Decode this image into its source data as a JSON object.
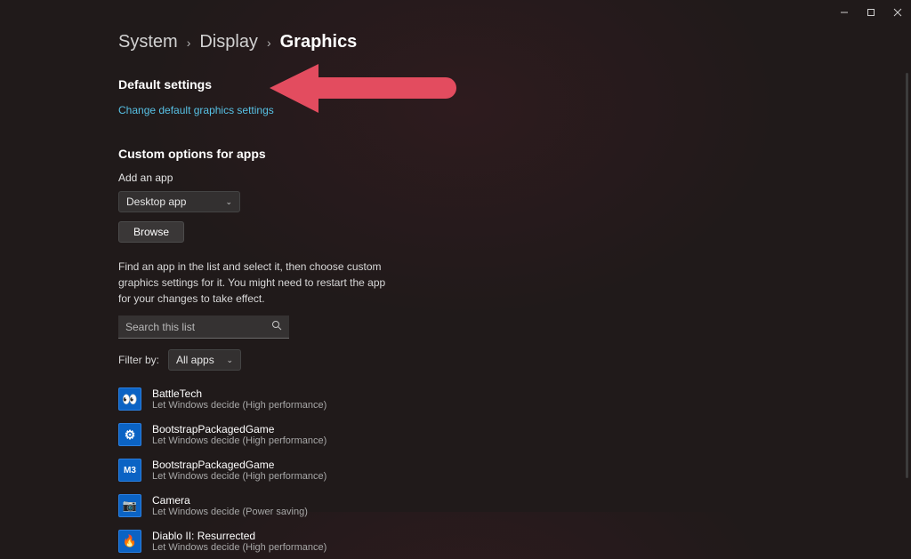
{
  "breadcrumb": {
    "c1": "System",
    "c2": "Display",
    "c3": "Graphics"
  },
  "default": {
    "heading": "Default settings",
    "link": "Change default graphics settings"
  },
  "annotation": {
    "arrow_color": "#e34c5f"
  },
  "custom": {
    "heading": "Custom options for apps",
    "add_label": "Add an app",
    "app_type_selected": "Desktop app",
    "browse_label": "Browse",
    "helper": "Find an app in the list and select it, then choose custom graphics settings for it. You might need to restart the app for your changes to take effect.",
    "search_placeholder": "Search this list",
    "filter_label": "Filter by:",
    "filter_selected": "All apps"
  },
  "apps": [
    {
      "icon": "yellow",
      "name": "BattleTech",
      "sub": "Let Windows decide (High performance)"
    },
    {
      "icon": "gear",
      "name": "BootstrapPackagedGame",
      "sub": "Let Windows decide (High performance)"
    },
    {
      "icon": "m3",
      "txt": "M3",
      "name": "BootstrapPackagedGame",
      "sub": "Let Windows decide (High performance)"
    },
    {
      "icon": "cam",
      "name": "Camera",
      "sub": "Let Windows decide (Power saving)"
    },
    {
      "icon": "d2",
      "name": "Diablo II: Resurrected",
      "sub": "Let Windows decide (High performance)"
    }
  ]
}
